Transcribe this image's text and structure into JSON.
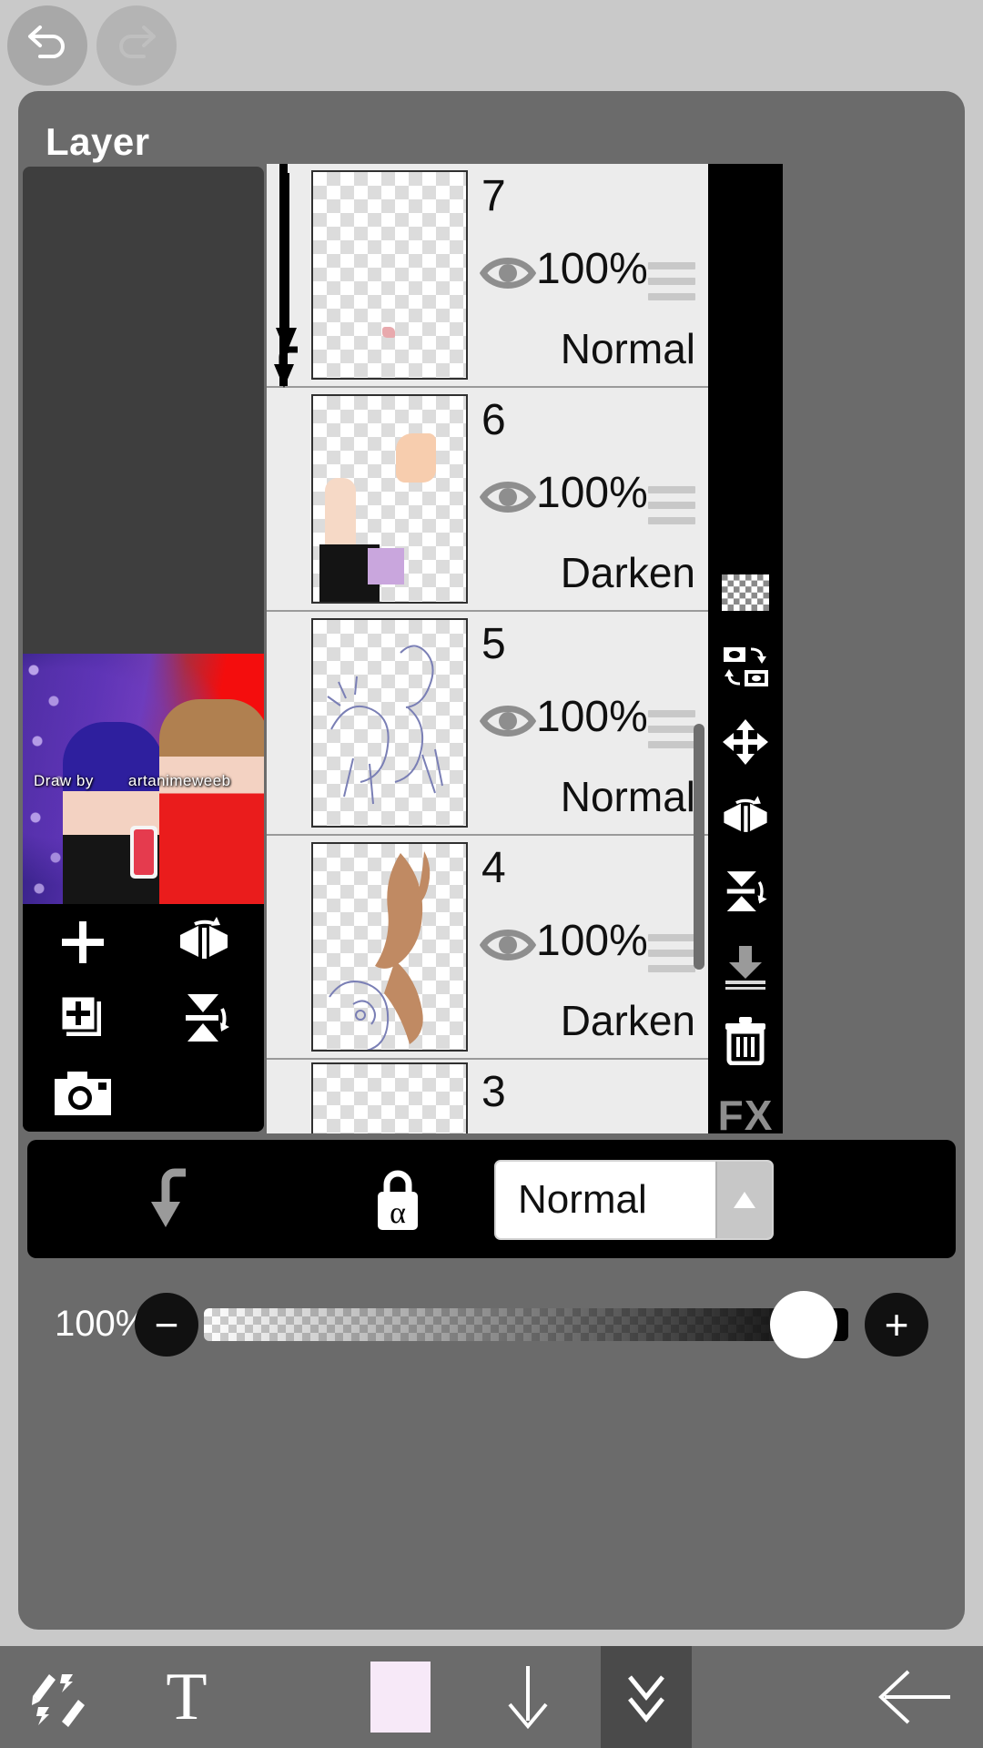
{
  "topbar": {
    "undo": {
      "label": "Undo",
      "icon": "undo-icon",
      "enabled": true
    },
    "redo": {
      "label": "Redo",
      "icon": "redo-icon",
      "enabled": false
    }
  },
  "panel": {
    "title": "Layer"
  },
  "preview": {
    "watermark_prefix": "Draw by",
    "watermark_user": "artanimeweeb"
  },
  "left_tools": [
    {
      "name": "add-layer-button",
      "icon": "plus-icon"
    },
    {
      "name": "flip-horizontal-button",
      "icon": "flip-horizontal-icon"
    },
    {
      "name": "duplicate-layer-button",
      "icon": "duplicate-layer-icon"
    },
    {
      "name": "flip-vertical-button",
      "icon": "flip-vertical-icon"
    },
    {
      "name": "import-photo-button",
      "icon": "camera-icon"
    }
  ],
  "layers": [
    {
      "number": "7",
      "opacity": "100%",
      "blend": "Normal",
      "visible": true,
      "clipping": true,
      "selected": true
    },
    {
      "number": "6",
      "opacity": "100%",
      "blend": "Darken",
      "visible": true,
      "clipping": false,
      "selected": false
    },
    {
      "number": "5",
      "opacity": "100%",
      "blend": "Normal",
      "visible": true,
      "clipping": false,
      "selected": false
    },
    {
      "number": "4",
      "opacity": "100%",
      "blend": "Darken",
      "visible": true,
      "clipping": false,
      "selected": false
    },
    {
      "number": "3",
      "opacity": "",
      "blend": "",
      "visible": true,
      "clipping": false,
      "selected": false
    }
  ],
  "right_toolbar": [
    {
      "name": "transparency-button",
      "icon": "checkerboard-icon",
      "enabled": true
    },
    {
      "name": "rotate-canvas-button",
      "icon": "rotate-canvas-icon",
      "enabled": true
    },
    {
      "name": "move-layer-button",
      "icon": "move-icon",
      "enabled": true
    },
    {
      "name": "flip-horizontal-button",
      "icon": "flip-horizontal-icon",
      "enabled": true
    },
    {
      "name": "flip-vertical-button",
      "icon": "flip-vertical-icon",
      "enabled": true
    },
    {
      "name": "merge-down-button",
      "icon": "merge-down-icon",
      "enabled": false
    },
    {
      "name": "delete-layer-button",
      "icon": "trash-icon",
      "enabled": true
    },
    {
      "name": "fx-button",
      "icon": "fx-icon",
      "label": "FX",
      "enabled": false
    },
    {
      "name": "more-options-button",
      "icon": "more-vertical-icon",
      "enabled": true
    }
  ],
  "blend_bar": {
    "clipping_icon": "clipping-arrow-icon",
    "alpha_lock_icon": "alpha-lock-icon",
    "alpha_lock_glyph": "α",
    "blend_mode": "Normal",
    "dropdown_icon": "triangle-up-icon"
  },
  "opacity_bar": {
    "value": "100%",
    "minus_label": "−",
    "plus_label": "+",
    "slider_position_percent": 100
  },
  "bottom_nav": [
    {
      "name": "brush-eraser-tool",
      "icon": "brush-eraser-icon",
      "active": false
    },
    {
      "name": "text-tool",
      "icon": "text-icon",
      "label": "T",
      "active": false
    },
    {
      "name": "color-swatch",
      "icon": "color-swatch-icon",
      "color": "#f7e9f8",
      "active": false
    },
    {
      "name": "download-button",
      "icon": "arrow-down-icon",
      "active": false
    },
    {
      "name": "collapse-panel-button",
      "icon": "double-chevron-down-icon",
      "active": true
    },
    {
      "name": "back-button",
      "icon": "arrow-left-icon",
      "active": false
    }
  ],
  "colors": {
    "panel_bg": "#6b6b6b",
    "page_bg": "#c9c9c9",
    "list_bg": "#ececec",
    "toolbar_bg": "#000000",
    "swatch": "#f7e9f8"
  }
}
